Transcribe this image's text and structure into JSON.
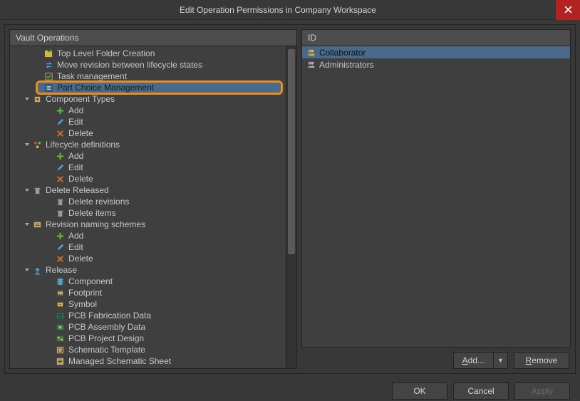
{
  "window": {
    "title": "Edit Operation Permissions in Company Workspace"
  },
  "left": {
    "header": "Vault Operations",
    "items": [
      {
        "lvl": 1,
        "exp": "",
        "icon": "folder-plus",
        "label": "Top Level Folder Creation"
      },
      {
        "lvl": 1,
        "exp": "",
        "icon": "arrows",
        "label": "Move revision between lifecycle states"
      },
      {
        "lvl": 1,
        "exp": "",
        "icon": "task",
        "label": "Task management"
      },
      {
        "lvl": 1,
        "exp": "",
        "icon": "list",
        "label": "Part Choice Management",
        "selected": true
      },
      {
        "lvl": 0,
        "exp": "▢",
        "icon": "comp",
        "label": "Component Types"
      },
      {
        "lvl": 2,
        "exp": "",
        "icon": "add",
        "label": "Add"
      },
      {
        "lvl": 2,
        "exp": "",
        "icon": "edit",
        "label": "Edit"
      },
      {
        "lvl": 2,
        "exp": "",
        "icon": "del",
        "label": "Delete"
      },
      {
        "lvl": 0,
        "exp": "▢",
        "icon": "life",
        "label": "Lifecycle definitions"
      },
      {
        "lvl": 2,
        "exp": "",
        "icon": "add",
        "label": "Add"
      },
      {
        "lvl": 2,
        "exp": "",
        "icon": "edit",
        "label": "Edit"
      },
      {
        "lvl": 2,
        "exp": "",
        "icon": "del",
        "label": "Delete"
      },
      {
        "lvl": 0,
        "exp": "▢",
        "icon": "trash",
        "label": "Delete Released"
      },
      {
        "lvl": 2,
        "exp": "",
        "icon": "trash",
        "label": "Delete revisions"
      },
      {
        "lvl": 2,
        "exp": "",
        "icon": "trash",
        "label": "Delete items"
      },
      {
        "lvl": 0,
        "exp": "▢",
        "icon": "rev",
        "label": "Revision naming schemes"
      },
      {
        "lvl": 2,
        "exp": "",
        "icon": "add",
        "label": "Add"
      },
      {
        "lvl": 2,
        "exp": "",
        "icon": "edit",
        "label": "Edit"
      },
      {
        "lvl": 2,
        "exp": "",
        "icon": "del",
        "label": "Delete"
      },
      {
        "lvl": 0,
        "exp": "▢",
        "icon": "release",
        "label": "Release"
      },
      {
        "lvl": 2,
        "exp": "",
        "icon": "component",
        "label": "Component"
      },
      {
        "lvl": 2,
        "exp": "",
        "icon": "footprint",
        "label": "Footprint"
      },
      {
        "lvl": 2,
        "exp": "",
        "icon": "symbol",
        "label": "Symbol"
      },
      {
        "lvl": 2,
        "exp": "",
        "icon": "pcbfab",
        "label": "PCB Fabrication Data"
      },
      {
        "lvl": 2,
        "exp": "",
        "icon": "pcbasm",
        "label": "PCB Assembly Data"
      },
      {
        "lvl": 2,
        "exp": "",
        "icon": "pcbproj",
        "label": "PCB Project Design"
      },
      {
        "lvl": 2,
        "exp": "",
        "icon": "schtpl",
        "label": "Schematic Template"
      },
      {
        "lvl": 2,
        "exp": "",
        "icon": "mschsheet",
        "label": "Managed Schematic Sheet"
      }
    ]
  },
  "right": {
    "header": "ID",
    "rows": [
      {
        "icon": "roles",
        "label": "Collaborator",
        "selected": true
      },
      {
        "icon": "roles",
        "label": "Administrators",
        "selected": false
      }
    ],
    "buttons": {
      "add": "Add...",
      "remove": "Remove"
    }
  },
  "footer": {
    "ok": "OK",
    "cancel": "Cancel",
    "apply": "Apply"
  },
  "icon_colors": {
    "add": "#5bbf3a",
    "edit": "#4aa3d8",
    "del": "#d9643a",
    "folder": "#d9b24a",
    "life": "#d9b24a",
    "trash": "#9a9a9a",
    "release": "#4aa3d8",
    "generic": "#c7a864"
  }
}
